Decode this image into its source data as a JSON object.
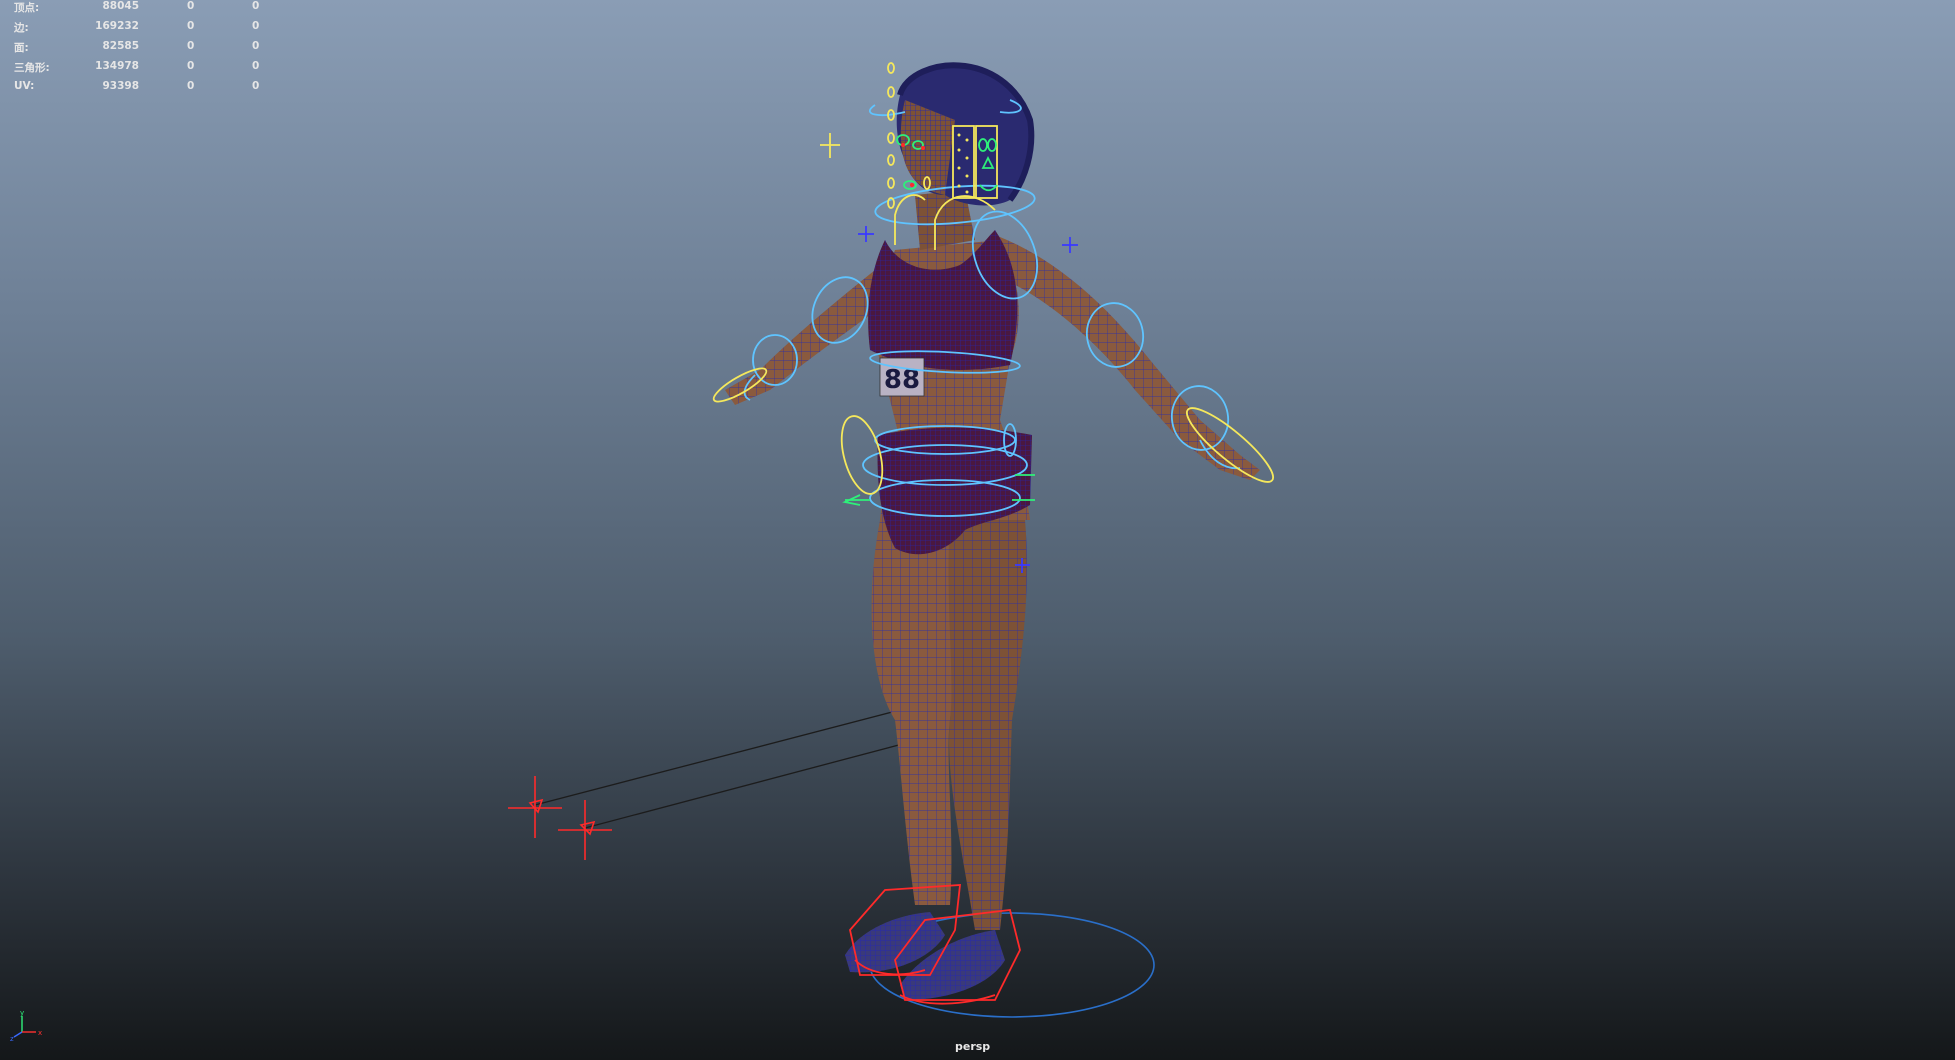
{
  "heads_up_display": {
    "rows": [
      {
        "label": "顶点:",
        "value": "88045",
        "v2": "0",
        "v3": "0"
      },
      {
        "label": "边:",
        "value": "169232",
        "v2": "0",
        "v3": "0"
      },
      {
        "label": "面:",
        "value": "82585",
        "v2": "0",
        "v3": "0"
      },
      {
        "label": "三角形:",
        "value": "134978",
        "v2": "0",
        "v3": "0"
      },
      {
        "label": "UV:",
        "value": "93398",
        "v2": "0",
        "v3": "0"
      }
    ]
  },
  "viewport": {
    "camera_label": "persp",
    "background_top": "#8a9db5",
    "background_bottom": "#141719"
  },
  "scene": {
    "bib_number": "88",
    "rig_colors": {
      "fk_controls": "#5fc4ff",
      "ik_controls": "#f5e85c",
      "facial_controls": "#2ef07a",
      "ik_poles_and_feet": "#ff2a2a",
      "root_control": "#2a6fc9",
      "mesh_wire": "#2a2fa8",
      "skin": "#8a5a3e",
      "garment": "#4a1840"
    }
  },
  "axis_gizmo": {
    "y": "y",
    "x": "x",
    "z": "z"
  }
}
